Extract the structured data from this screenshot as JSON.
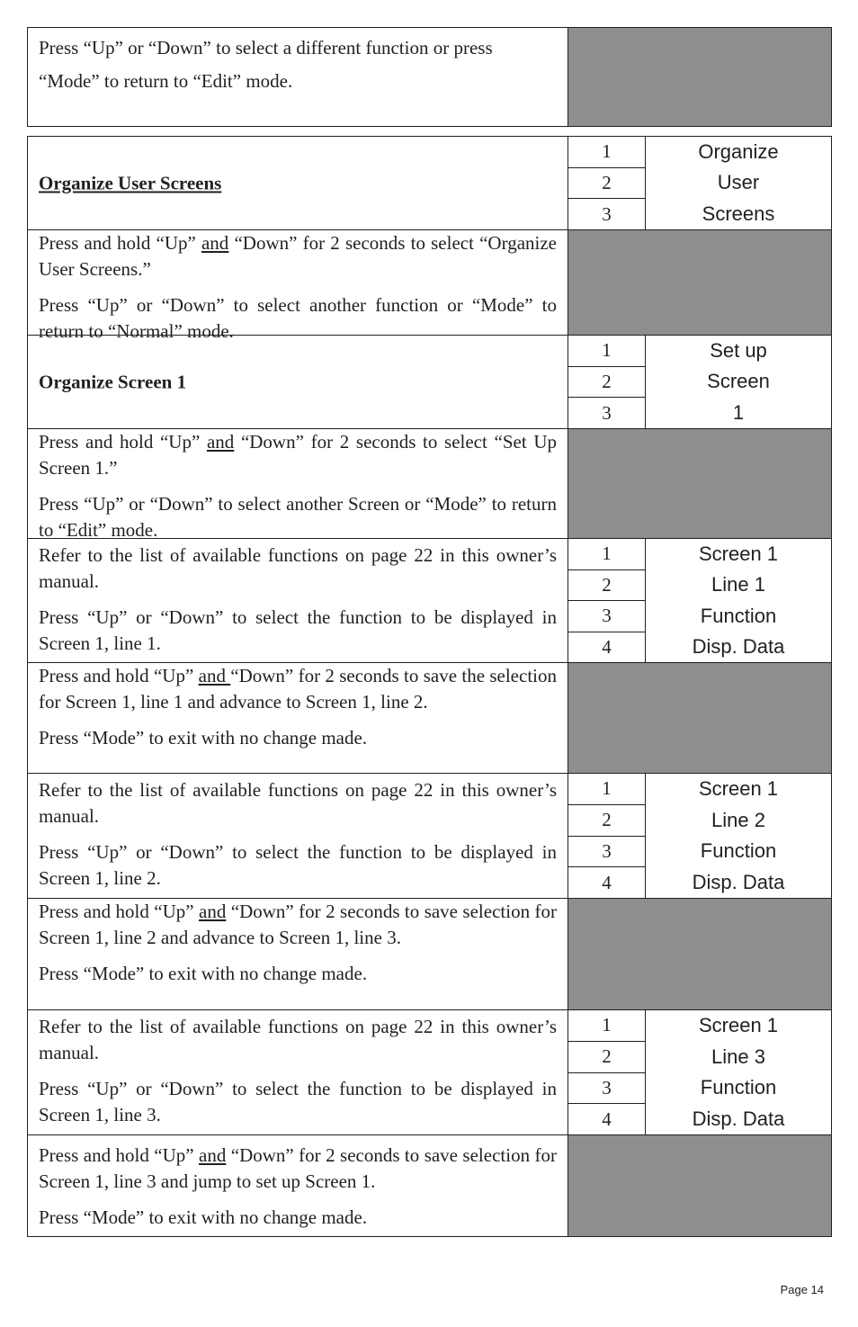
{
  "intro_box": {
    "paragraphs": [
      "Press “Up” or “Down” to select a different function or press",
      "“Mode” to return to “Edit” mode."
    ]
  },
  "sections": {
    "organize_user_screens": {
      "title": "Organize User Screens",
      "numbers": [
        "1",
        "2",
        "3"
      ],
      "display": [
        "Organize",
        "User",
        "Screens"
      ],
      "instruction_p1_a": "Press and hold “Up” ",
      "instruction_p1_and": "and",
      "instruction_p1_b": " “Down” for 2 seconds to select “Organize User Screens.”",
      "instruction_p2": "Press “Up” or “Down” to select another function or “Mode” to return to “Normal” mode."
    },
    "organize_screen_1": {
      "title": "Organize Screen 1",
      "numbers": [
        "1",
        "2",
        "3"
      ],
      "display": [
        "Set up",
        "Screen",
        "1"
      ],
      "instruction_p1_a": "Press and hold “Up” ",
      "instruction_p1_and": "and",
      "instruction_p1_b": " “Down” for 2 seconds to select “Set Up Screen 1.”",
      "instruction_p2": "Press “Up” or “Down” to select another Screen or “Mode” to return to “Edit” mode."
    },
    "line_1": {
      "p1": "Refer to the list of available functions on page 22 in this owner’s manual.",
      "p2": "Press  “Up” or “Down” to select the function to be displayed in Screen 1, line 1.",
      "numbers": [
        "1",
        "2",
        "3",
        "4"
      ],
      "display": [
        "Screen 1",
        "Line 1",
        "Function",
        "Disp. Data"
      ],
      "save_p1_a": "Press and hold “Up” ",
      "save_p1_and": "and ",
      "save_p1_b": "“Down” for 2 seconds to save the selection for Screen 1, line 1 and advance to Screen 1, line 2.",
      "save_p2": "Press “Mode” to exit with no change made."
    },
    "line_2": {
      "p1": "Refer to the list of available functions on page 22 in this owner’s manual.",
      "p2": "Press “Up” or “Down” to select the function to be displayed in Screen 1, line 2.",
      "numbers": [
        "1",
        "2",
        "3",
        "4"
      ],
      "display": [
        "Screen 1",
        "Line 2",
        "Function",
        "Disp. Data"
      ],
      "save_p1_a": "Press and hold “Up” ",
      "save_p1_and": "and",
      "save_p1_b": " “Down” for 2 seconds to save selection for Screen 1, line 2 and advance to Screen 1, line 3.",
      "save_p2": "Press “Mode” to exit with no change made."
    },
    "line_3": {
      "p1": "Refer to the list of available functions on page 22 in this owner’s manual.",
      "p2": "Press “Up” or “Down” to select  the function to be displayed in Screen 1, line 3.",
      "numbers": [
        "1",
        "2",
        "3",
        "4"
      ],
      "display": [
        "Screen 1",
        "Line 3",
        "Function",
        "Disp. Data"
      ],
      "save_p1_a": "Press and hold “Up” ",
      "save_p1_and": "and",
      "save_p1_b": " “Down” for 2 seconds to save selection for Screen 1, line 3 and jump to set up Screen 1.",
      "save_p2": "Press “Mode” to exit with no change made."
    }
  },
  "footer": {
    "page_label": "Page 14"
  },
  "colors": {
    "shade": "#8f8d8e",
    "ink": "#231f20"
  }
}
